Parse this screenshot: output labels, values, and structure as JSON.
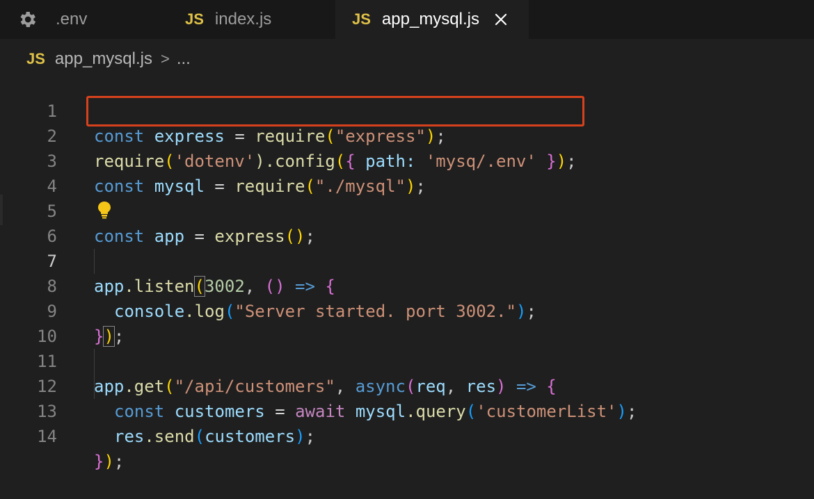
{
  "tabs": [
    {
      "label": ".env",
      "icon": "gear-icon",
      "active": false
    },
    {
      "label": "index.js",
      "icon": "js-file-icon",
      "badge": "JS",
      "active": false
    },
    {
      "label": "app_mysql.js",
      "icon": "js-file-icon",
      "badge": "JS",
      "active": true
    }
  ],
  "breadcrumb": {
    "badge": "JS",
    "file": "app_mysql.js",
    "separator": ">",
    "more": "..."
  },
  "code_lines": [
    {
      "number": "1"
    },
    {
      "number": "2"
    },
    {
      "number": "3"
    },
    {
      "number": "4"
    },
    {
      "number": "5"
    },
    {
      "number": "6"
    },
    {
      "number": "7"
    },
    {
      "number": "8"
    },
    {
      "number": "9"
    },
    {
      "number": "10"
    },
    {
      "number": "11"
    },
    {
      "number": "12"
    },
    {
      "number": "13"
    },
    {
      "number": "14"
    }
  ],
  "code": {
    "l1": [
      "const",
      "express",
      "=",
      "require",
      "(",
      "\"express\"",
      ")",
      ";"
    ],
    "l2": [
      "require",
      "(",
      "'dotenv'",
      ").config",
      "(",
      "{",
      "path:",
      "'mysq/.env'",
      "}",
      ")",
      ";"
    ],
    "l3": [
      "const",
      "mysql",
      "=",
      "require",
      "(",
      "\"./mysql\"",
      ")",
      ";"
    ],
    "l5": [
      "const",
      "app",
      "=",
      "express",
      "(",
      ")",
      ";"
    ],
    "l7": [
      "app",
      ".listen",
      "(",
      "3002",
      ",",
      "(",
      ")",
      "=>",
      "{"
    ],
    "l8": [
      "console",
      ".log",
      "(",
      "\"Server started. port 3002.\"",
      ")",
      ";"
    ],
    "l9": [
      "}",
      ")",
      ";"
    ],
    "l11": [
      "app",
      ".get",
      "(",
      "\"/api/customers\"",
      ",",
      "async",
      "(",
      "req",
      ",",
      "res",
      ")",
      "=>",
      "{"
    ],
    "l12": [
      "const",
      "customers",
      "=",
      "await",
      "mysql",
      ".query",
      "(",
      "'customerList'",
      ")",
      ";"
    ],
    "l13": [
      "res",
      ".send",
      "(",
      "customers",
      ")",
      ";"
    ],
    "l14": [
      "}",
      ")",
      ";"
    ]
  },
  "colors": {
    "highlight_border": "#d7421c",
    "js_badge": "#e0c248"
  }
}
